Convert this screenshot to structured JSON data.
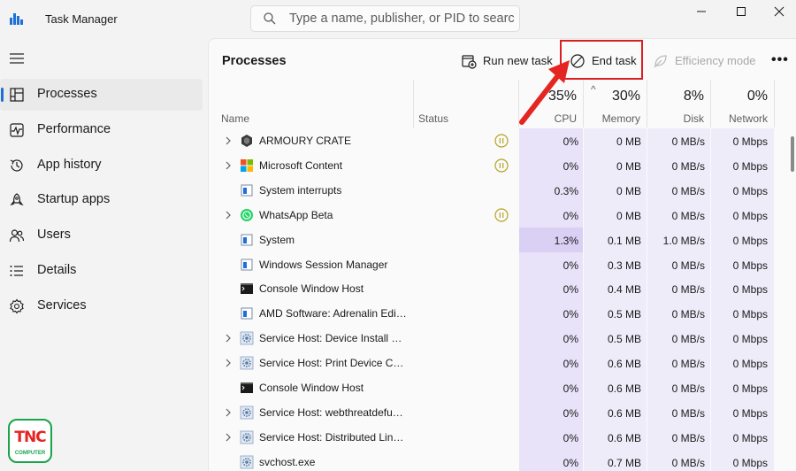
{
  "app": {
    "title": "Task Manager"
  },
  "search": {
    "placeholder": "Type a name, publisher, or PID to search"
  },
  "sidebar": {
    "items": [
      {
        "label": "Processes",
        "icon": "processes-icon"
      },
      {
        "label": "Performance",
        "icon": "performance-icon"
      },
      {
        "label": "App history",
        "icon": "app-history-icon"
      },
      {
        "label": "Startup apps",
        "icon": "startup-apps-icon"
      },
      {
        "label": "Users",
        "icon": "users-icon"
      },
      {
        "label": "Details",
        "icon": "details-icon"
      },
      {
        "label": "Services",
        "icon": "services-icon"
      }
    ],
    "active_index": 0
  },
  "logo": {
    "text": "TNC",
    "subtext": "COMPUTER"
  },
  "toolbar": {
    "page_title": "Processes",
    "run_new_task": "Run new task",
    "end_task": "End task",
    "efficiency_mode": "Efficiency mode",
    "more": "•••"
  },
  "columns": {
    "name": "Name",
    "status": "Status",
    "cpu": {
      "pct": "35%",
      "label": "CPU"
    },
    "memory": {
      "pct": "30%",
      "label": "Memory"
    },
    "disk": {
      "pct": "8%",
      "label": "Disk"
    },
    "network": {
      "pct": "0%",
      "label": "Network"
    },
    "sort_indicator": "^"
  },
  "processes": [
    {
      "name": "ARMOURY CRATE",
      "expandable": true,
      "icon": "armoury-crate-icon",
      "paused": true,
      "cpu": "0%",
      "memory": "0 MB",
      "disk": "0 MB/s",
      "network": "0 Mbps"
    },
    {
      "name": "Microsoft Content",
      "expandable": true,
      "icon": "microsoft-logo-icon",
      "paused": true,
      "cpu": "0%",
      "memory": "0 MB",
      "disk": "0 MB/s",
      "network": "0 Mbps"
    },
    {
      "name": "System interrupts",
      "expandable": false,
      "icon": "window-app-icon",
      "paused": false,
      "cpu": "0.3%",
      "memory": "0 MB",
      "disk": "0 MB/s",
      "network": "0 Mbps"
    },
    {
      "name": "WhatsApp Beta",
      "expandable": true,
      "icon": "whatsapp-icon",
      "paused": true,
      "cpu": "0%",
      "memory": "0 MB",
      "disk": "0 MB/s",
      "network": "0 Mbps"
    },
    {
      "name": "System",
      "expandable": false,
      "icon": "window-app-icon",
      "paused": false,
      "cpu": "1.3%",
      "memory": "0.1 MB",
      "disk": "1.0 MB/s",
      "network": "0 Mbps"
    },
    {
      "name": "Windows Session Manager",
      "expandable": false,
      "icon": "window-app-icon",
      "paused": false,
      "cpu": "0%",
      "memory": "0.3 MB",
      "disk": "0 MB/s",
      "network": "0 Mbps"
    },
    {
      "name": "Console Window Host",
      "expandable": false,
      "icon": "console-icon",
      "paused": false,
      "cpu": "0%",
      "memory": "0.4 MB",
      "disk": "0 MB/s",
      "network": "0 Mbps"
    },
    {
      "name": "AMD Software: Adrenalin Edit...",
      "expandable": false,
      "icon": "window-app-icon",
      "paused": false,
      "cpu": "0%",
      "memory": "0.5 MB",
      "disk": "0 MB/s",
      "network": "0 Mbps"
    },
    {
      "name": "Service Host: Device Install Se...",
      "expandable": true,
      "icon": "gear-service-icon",
      "paused": false,
      "cpu": "0%",
      "memory": "0.5 MB",
      "disk": "0 MB/s",
      "network": "0 Mbps"
    },
    {
      "name": "Service Host: Print Device Con...",
      "expandable": true,
      "icon": "gear-service-icon",
      "paused": false,
      "cpu": "0%",
      "memory": "0.6 MB",
      "disk": "0 MB/s",
      "network": "0 Mbps"
    },
    {
      "name": "Console Window Host",
      "expandable": false,
      "icon": "console-icon",
      "paused": false,
      "cpu": "0%",
      "memory": "0.6 MB",
      "disk": "0 MB/s",
      "network": "0 Mbps"
    },
    {
      "name": "Service Host: webthreatdefuse...",
      "expandable": true,
      "icon": "gear-service-icon",
      "paused": false,
      "cpu": "0%",
      "memory": "0.6 MB",
      "disk": "0 MB/s",
      "network": "0 Mbps"
    },
    {
      "name": "Service Host: Distributed Link ...",
      "expandable": true,
      "icon": "gear-service-icon",
      "paused": false,
      "cpu": "0%",
      "memory": "0.6 MB",
      "disk": "0 MB/s",
      "network": "0 Mbps"
    },
    {
      "name": "svchost.exe",
      "expandable": false,
      "icon": "gear-service-icon",
      "paused": false,
      "cpu": "0%",
      "memory": "0.7 MB",
      "disk": "0 MB/s",
      "network": "0 Mbps"
    }
  ],
  "colors": {
    "accent": "#1e6fd9",
    "highlight_box": "#d91f1f",
    "cpu_cell_bg": "#e8e3f8",
    "cpu_cell_bg_strong": "#d9d0f4",
    "mem_cell_bg": "#efecfa",
    "paused_icon": "#b3a321"
  }
}
